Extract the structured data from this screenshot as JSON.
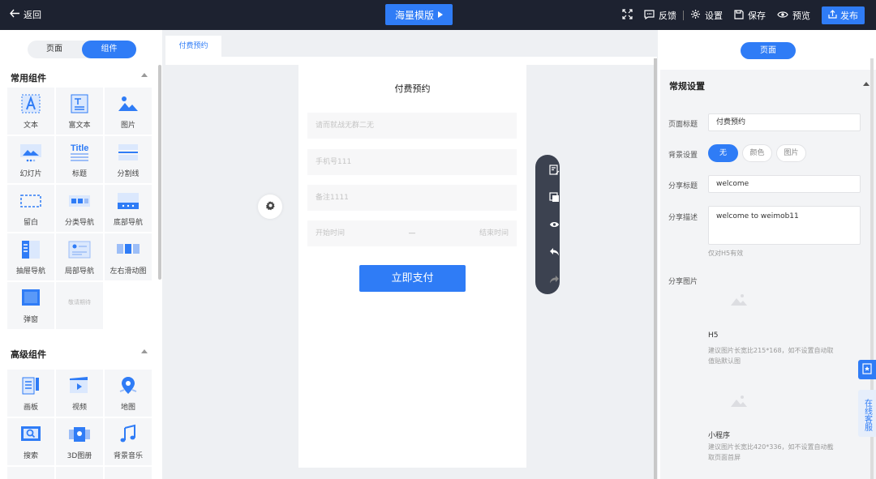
{
  "topbar": {
    "back_label": "返回",
    "template_label": "海量模版",
    "feedback_label": "反馈",
    "settings_label": "设置",
    "save_label": "保存",
    "preview_label": "预览",
    "publish_label": "发布"
  },
  "left": {
    "tabs": [
      "页面",
      "组件"
    ],
    "common_title": "常用组件",
    "common": [
      "文本",
      "富文本",
      "图片",
      "幻灯片",
      "标题",
      "分割线",
      "留白",
      "分类导航",
      "底部导航",
      "抽屉导航",
      "局部导航",
      "左右滑动图",
      "弹窗"
    ],
    "placeholder_cell": "敬请期待",
    "advanced_title": "高级组件",
    "advanced": [
      "画板",
      "视频",
      "地图",
      "搜索",
      "3D图册",
      "背景音乐"
    ]
  },
  "canvas": {
    "tab": "付费预约",
    "page_title": "付费预约",
    "fields": [
      "请而就战无群二无",
      "手机号111",
      "备注1111"
    ],
    "start_time": "开始时间",
    "dash": "—",
    "end_time": "结束时间",
    "pay_button": "立即支付"
  },
  "right": {
    "tab": "页面",
    "section_title": "常规设置",
    "page_title_label": "页面标题",
    "page_title_value": "付费预约",
    "bg_label": "背景设置",
    "bg_options": [
      "无",
      "颜色",
      "图片"
    ],
    "share_title_label": "分享标题",
    "share_title_value": "welcome",
    "share_desc_label": "分享描述",
    "share_desc_value": "welcome to weimob11",
    "share_desc_note": "仅对H5有效",
    "share_img_label": "分享图片",
    "h5_caption": "H5",
    "h5_note": "建议图片长宽比215*168，如不设置自动取值贴默认图",
    "mini_caption": "小程序",
    "mini_note": "建议图片长宽比420*336，如不设置自动截取页面首屏",
    "service_label": "在线客服"
  },
  "colors": {
    "accent": "#2f7cf6",
    "topbar": "#1d2230",
    "toolbar": "#3c4250"
  }
}
